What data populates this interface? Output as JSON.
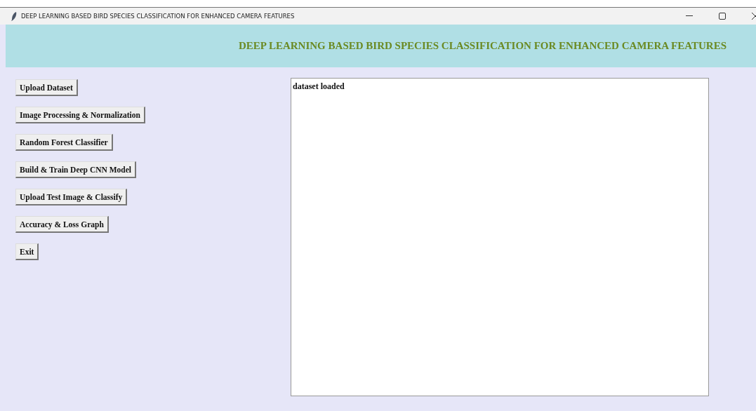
{
  "window": {
    "title": "DEEP LEARNING BASED BIRD SPECIES CLASSIFICATION FOR ENHANCED CAMERA FEATURES"
  },
  "header": {
    "title": "DEEP LEARNING BASED BIRD SPECIES CLASSIFICATION FOR ENHANCED CAMERA FEATURES"
  },
  "buttons": [
    "Upload Dataset",
    "Image Processing & Normalization",
    "Random Forest Classifier",
    "Build & Train Deep CNN Model",
    "Upload Test Image & Classify",
    "Accuracy & Loss Graph",
    "Exit"
  ],
  "output": {
    "text": "dataset loaded"
  }
}
